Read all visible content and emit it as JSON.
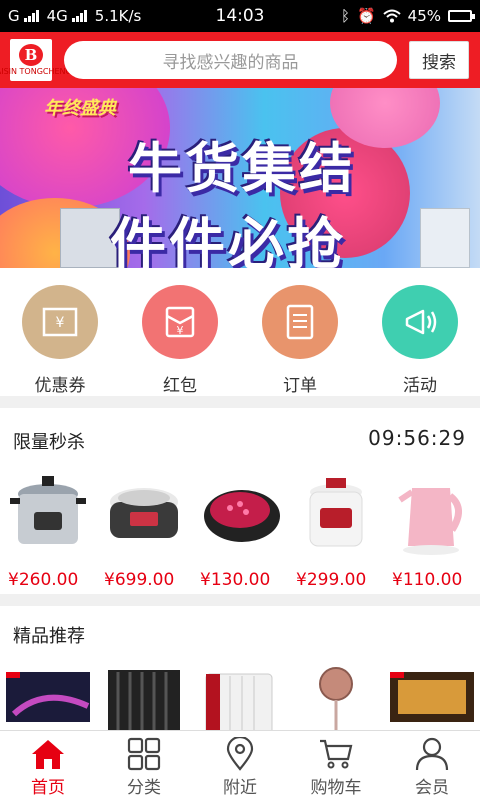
{
  "status_bar": {
    "carrier": "G",
    "network": "4G",
    "speed": "5.1K/s",
    "time": "14:03",
    "battery": "45%"
  },
  "header": {
    "logo_text": "BAISIN TONGCHENG",
    "search_placeholder": "寻找感兴趣的商品",
    "search_button": "搜索"
  },
  "banner": {
    "badge": "年终盛典",
    "line1": "牛货集结",
    "line2": "件件必抢"
  },
  "categories": [
    {
      "label": "优惠券",
      "icon": "coupon-icon",
      "color": "#d2b48c"
    },
    {
      "label": "红包",
      "icon": "red-packet-icon",
      "color": "#f27373"
    },
    {
      "label": "订单",
      "icon": "order-icon",
      "color": "#e8946c"
    },
    {
      "label": "活动",
      "icon": "activity-icon",
      "color": "#3fcfb0"
    }
  ],
  "flash_sale": {
    "title": "限量秒杀",
    "countdown": "09:56:29",
    "products": [
      {
        "price": "¥260.00",
        "icon": "pressure-cooker-icon"
      },
      {
        "price": "¥699.00",
        "icon": "rice-cooker-icon"
      },
      {
        "price": "¥130.00",
        "icon": "electric-griddle-icon"
      },
      {
        "price": "¥299.00",
        "icon": "pressure-cooker-icon"
      },
      {
        "price": "¥110.00",
        "icon": "kettle-icon"
      }
    ]
  },
  "featured": {
    "title": "精品推荐",
    "products": [
      {
        "icon": "tv-icon"
      },
      {
        "icon": "heater-icon"
      },
      {
        "icon": "oil-heater-icon"
      },
      {
        "icon": "fan-heater-icon"
      },
      {
        "icon": "tv-icon"
      }
    ]
  },
  "tabbar": [
    {
      "label": "首页",
      "icon": "home-icon",
      "active": true
    },
    {
      "label": "分类",
      "icon": "category-icon",
      "active": false
    },
    {
      "label": "附近",
      "icon": "location-icon",
      "active": false
    },
    {
      "label": "购物车",
      "icon": "cart-icon",
      "active": false
    },
    {
      "label": "会员",
      "icon": "member-icon",
      "active": false
    }
  ],
  "colors": {
    "brand_red": "#ee1d24",
    "price_red": "#e60012"
  }
}
